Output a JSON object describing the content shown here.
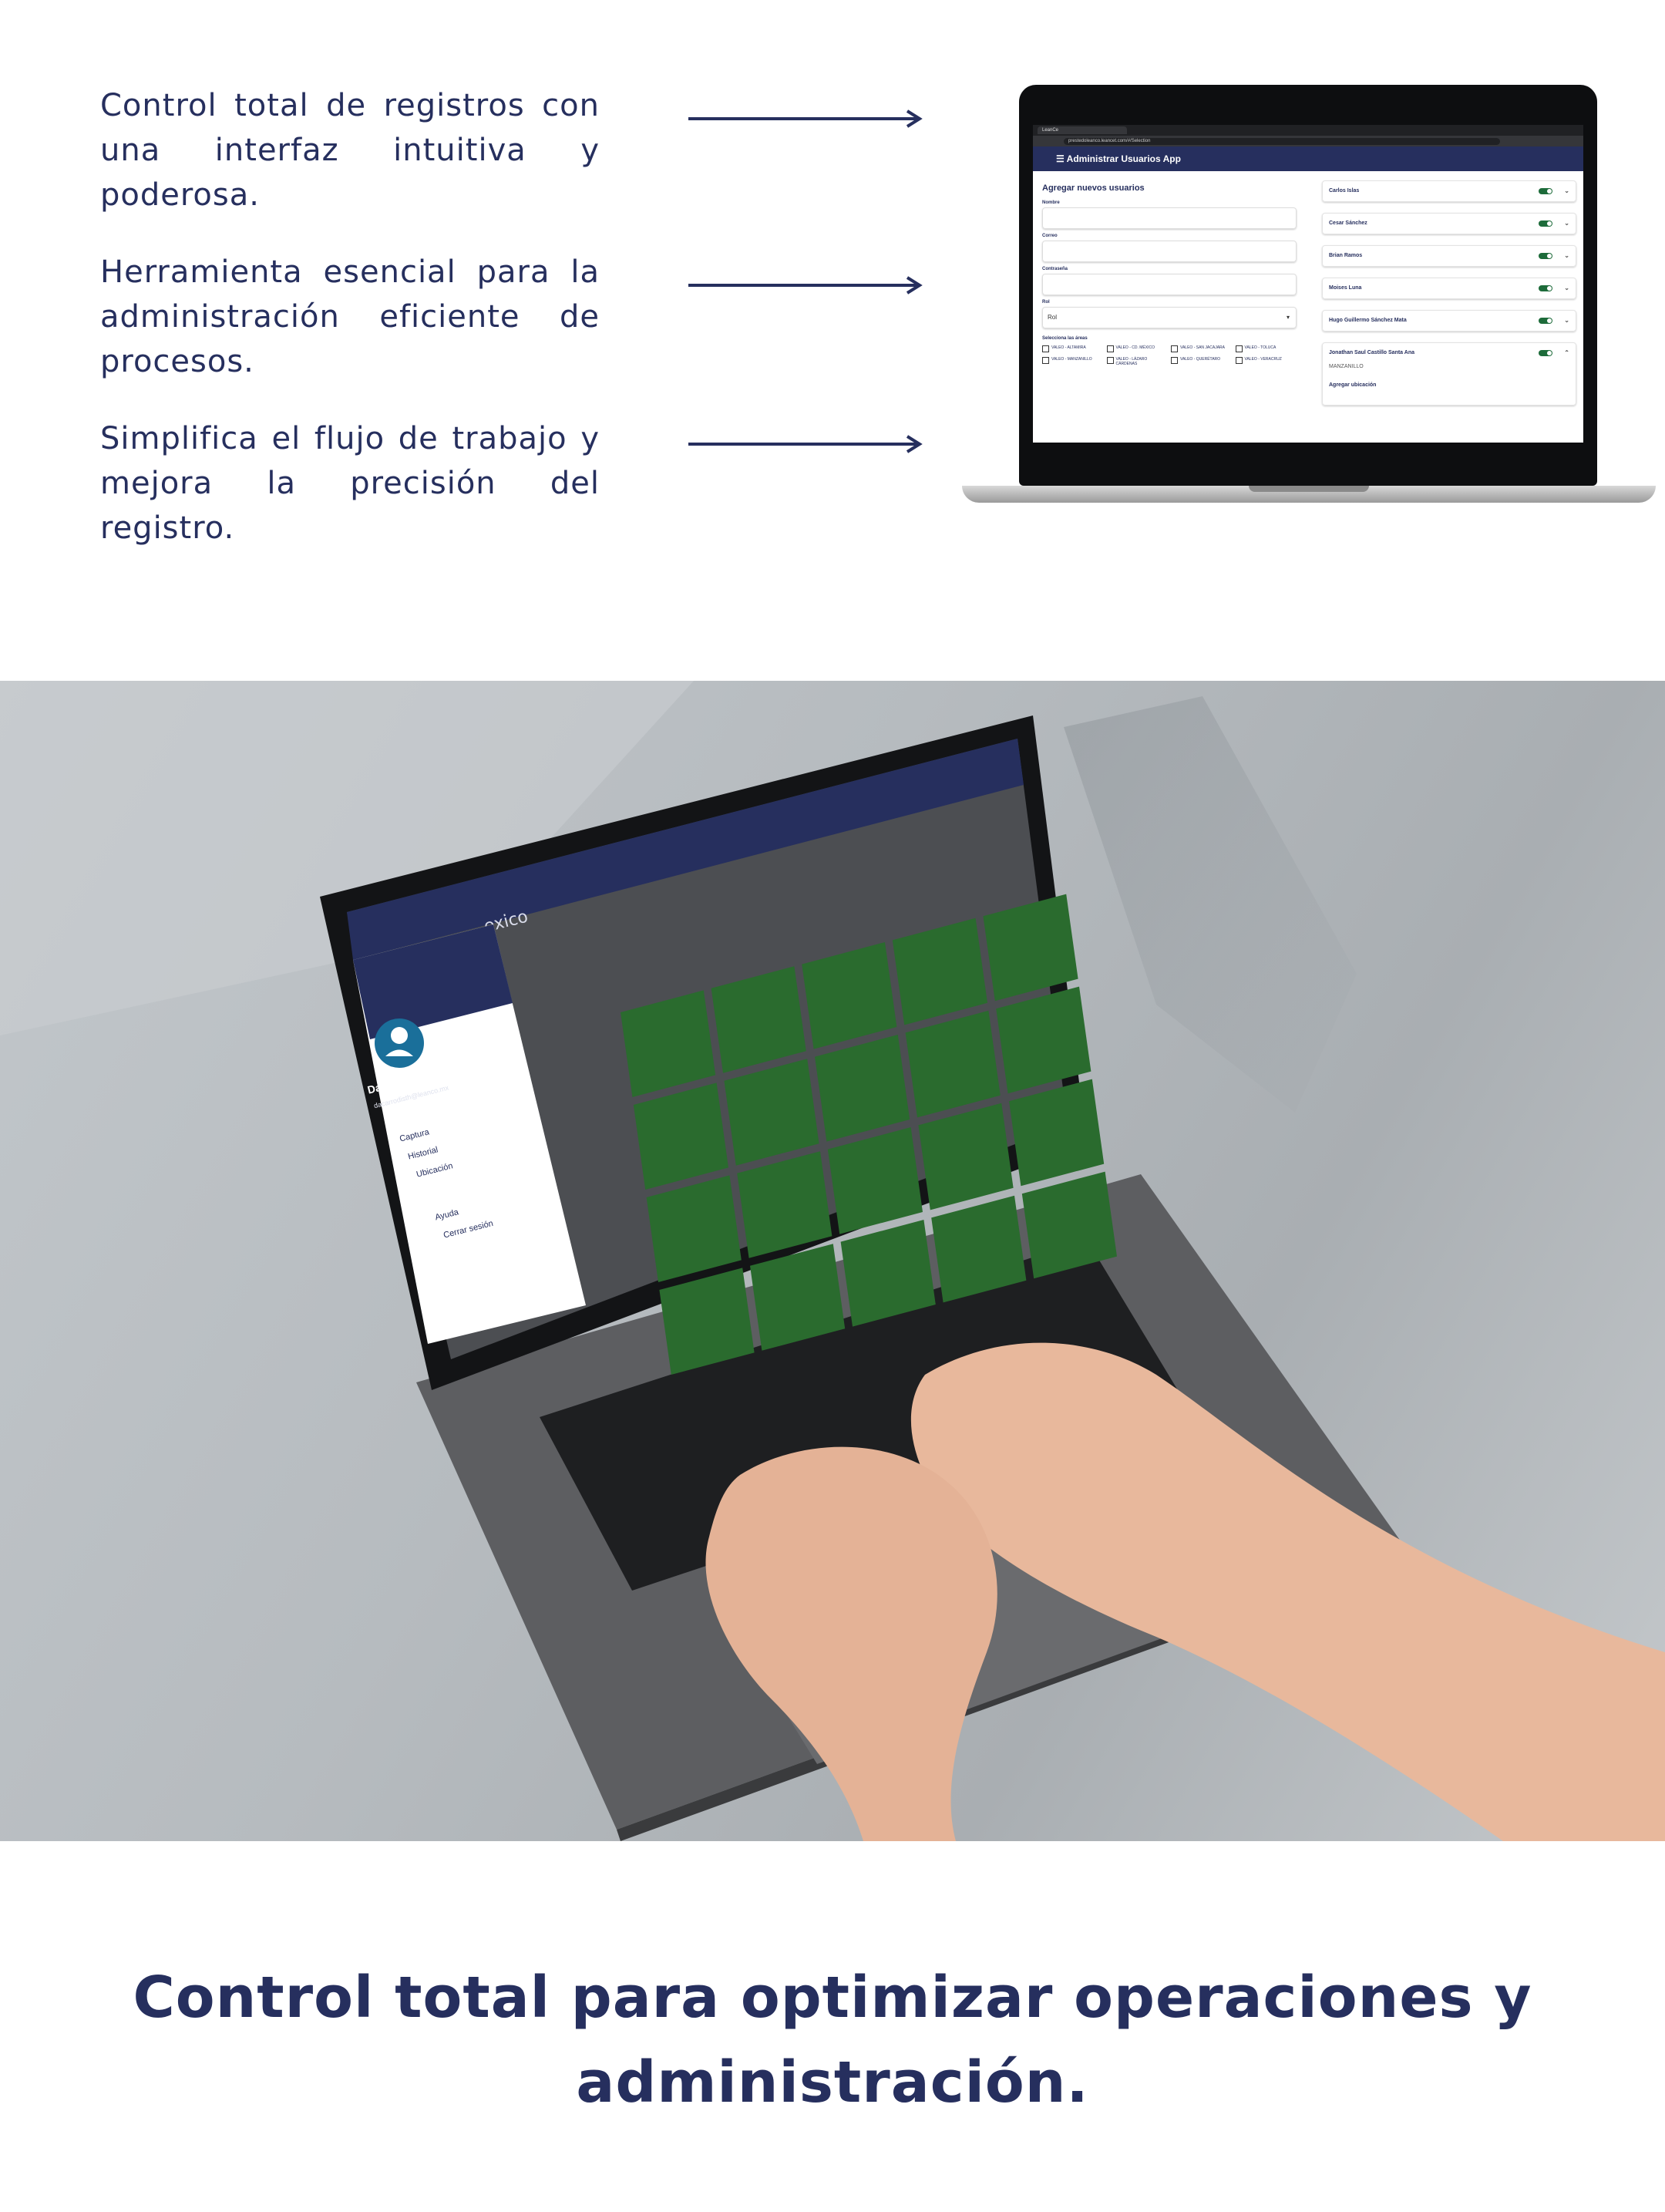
{
  "bullets": [
    "Control total de registros con una interfaz intuitiva y poderosa.",
    "Herramienta esencial para la administración eficiente de procesos.",
    "Simplifica el flujo de trabajo y mejora la precisión del registro."
  ],
  "laptop_screen": {
    "tab_title": "LeanCe",
    "url": "prestedoleanco.leancet.com/#/Selection",
    "app_title": "Administrar Usuarios App",
    "form_title": "Agregar nuevos usuarios",
    "fields": [
      {
        "label": "Nombre",
        "value": ""
      },
      {
        "label": "Correo",
        "value": ""
      },
      {
        "label": "Contraseña",
        "value": ""
      }
    ],
    "role_label": "Rol",
    "role_value": "Rol",
    "areas_label": "Selecciona las áreas",
    "areas": [
      "VALEO - ALTAMIRA",
      "VALEO - CD. MÉXICO",
      "VALEO - SAN JACAJARA",
      "VALEO - TOLUCA",
      "VALEO - MANZANILLO",
      "VALEO - LÁZARO CÁRDENAS",
      "VALEO - QUERÉTARO",
      "VALEO - VERACRUZ"
    ],
    "users": [
      "Carlos Islas",
      "Cesar Sánchez",
      "Brian Ramos",
      "Moises Luna",
      "Hugo Guillermo Sánchez Mata",
      "Jonathan Saul Castillo Santa Ana"
    ],
    "expanded_location": "MANZANILLO",
    "add_location": "Agregar ubicación"
  },
  "photo_screen": {
    "user_name": "Daniel León Sánchez",
    "user_email": "dacarrodisth@leanco.mx",
    "menu": [
      "Captura",
      "Historial",
      "Ubicación",
      "Ayuda",
      "Cerrar sesión"
    ],
    "header_fragment": "exico",
    "tile_count": 20
  },
  "headline": "Control total para optimizar operaciones y administración.",
  "colors": {
    "navy": "#262f5e",
    "tile_green": "#2a6b2e",
    "toggle_green": "#1d6b3a"
  }
}
